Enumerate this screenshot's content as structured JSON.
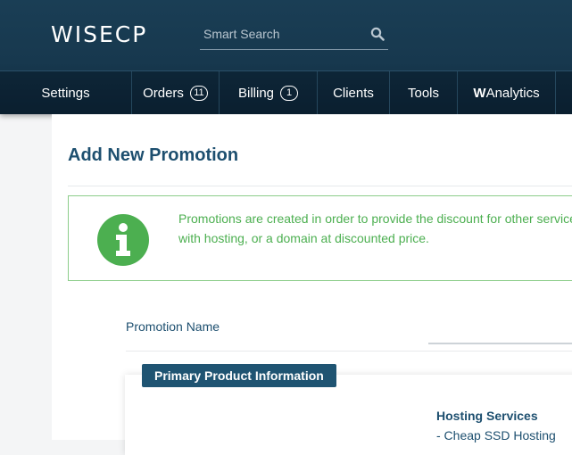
{
  "header": {
    "logo_text": "WISECP",
    "search": {
      "placeholder": "Smart Search",
      "value": ""
    },
    "nav": [
      {
        "label": "Settings"
      },
      {
        "label": "Orders",
        "badge": "11"
      },
      {
        "label": "Billing",
        "badge": "1"
      },
      {
        "label": "Clients"
      },
      {
        "label": "Tools"
      },
      {
        "label_bold": "W",
        "label_rest": "Analytics"
      }
    ]
  },
  "page": {
    "title": "Add New Promotion",
    "info": {
      "line1": "Promotions are created in order to provide the discount for other services, c",
      "line2": "with hosting, or a domain at discounted price."
    },
    "form": {
      "promotion_name_label": "Promotion Name",
      "promotion_name_value": ""
    },
    "primary_product": {
      "button_label": "Primary Product Information",
      "category_title": "Hosting Services",
      "category_item": "- Cheap SSD Hosting"
    }
  },
  "colors": {
    "header_bg": "#17384e",
    "accent_blue": "#1d4f6f",
    "info_green": "#4caf50"
  },
  "icons": [
    "search-icon",
    "info-icon"
  ]
}
